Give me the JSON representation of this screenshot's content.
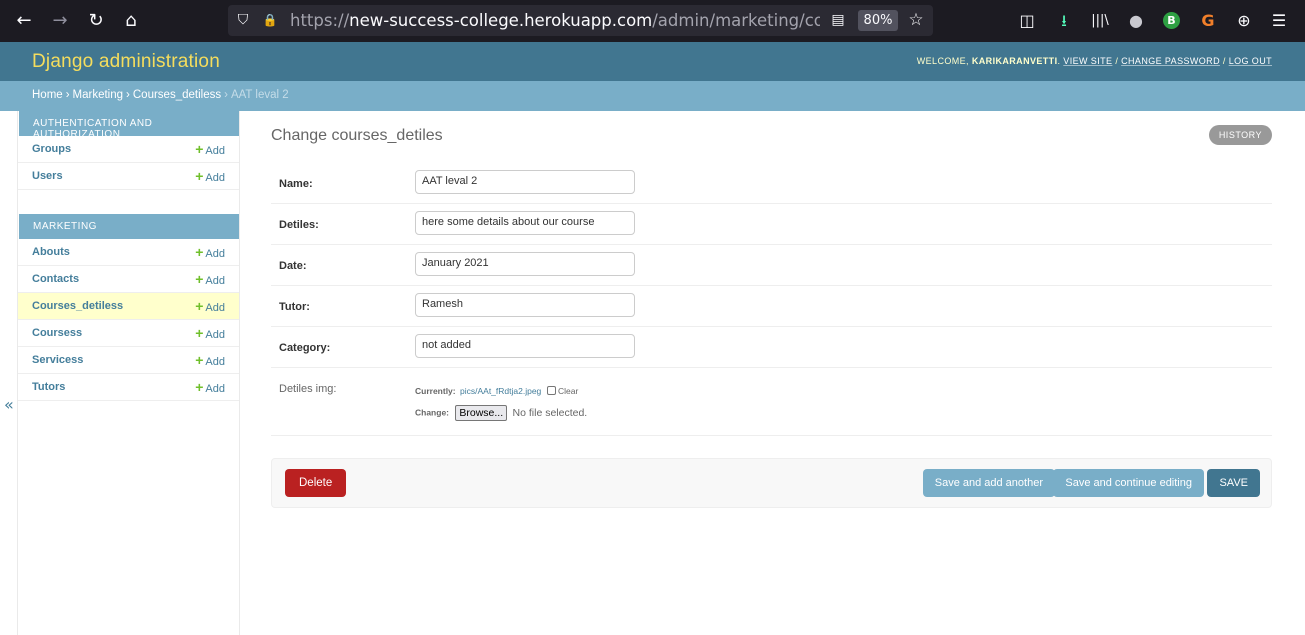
{
  "browser": {
    "url_prefix": "https://",
    "url_host": "new-success-college.herokuapp.com",
    "url_path": "/admin/marketing/courses_detil",
    "zoom": "80%",
    "nav_icons": {
      "back": "←",
      "forward": "→",
      "reload": "↻",
      "home": "⌂"
    },
    "toolbar_icons": {
      "pocket": "◫",
      "downloads": "⭳",
      "library": "|||\\",
      "account": "●",
      "ext_b": "B",
      "ext_g": "G",
      "ext_globe": "⊕",
      "menu": "☰",
      "shield": "⛉",
      "lock": "🔒",
      "reader": "▤",
      "bookmark": "☆"
    }
  },
  "header": {
    "brand": "Django administration",
    "welcome": "WELCOME,",
    "username": "KARIKARANVETTI",
    "view_site": "VIEW SITE",
    "change_password": "CHANGE PASSWORD",
    "log_out": "LOG OUT",
    "separator": "/"
  },
  "breadcrumbs": {
    "home": "Home",
    "app": "Marketing",
    "model": "Courses_detiless",
    "current": "AAT leval 2",
    "sep": "›"
  },
  "sidebar": {
    "toggle": "«",
    "add_label": "Add",
    "modules": [
      {
        "caption": "Authentication and Authorization",
        "models": [
          "Groups",
          "Users"
        ]
      },
      {
        "caption": "Marketing",
        "models": [
          "Abouts",
          "Contacts",
          "Courses_detiless",
          "Coursess",
          "Servicess",
          "Tutors"
        ]
      }
    ]
  },
  "content": {
    "title": "Change courses_detiles",
    "history": "History",
    "fields": {
      "name": {
        "label": "Name:",
        "value": "AAT leval 2"
      },
      "detiles": {
        "label": "Detiles:",
        "value": "here some details about our course"
      },
      "date": {
        "label": "Date:",
        "value": "January 2021"
      },
      "tutor": {
        "label": "Tutor:",
        "value": "Ramesh"
      },
      "category": {
        "label": "Category:",
        "value": "not added"
      }
    },
    "image_field": {
      "label": "Detiles img:",
      "currently": "Currently:",
      "file_link": "pics/AAt_fRdtja2.jpeg",
      "clear": "Clear",
      "change": "Change:",
      "browse": "Browse...",
      "no_file": "No file selected."
    },
    "submit": {
      "delete": "Delete",
      "save_add_another": "Save and add another",
      "save_continue": "Save and continue editing",
      "save": "SAVE"
    }
  }
}
